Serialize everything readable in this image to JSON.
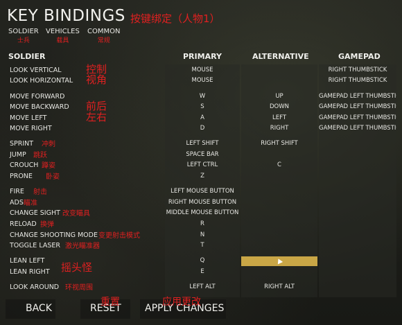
{
  "title": "KEY BINDINGS",
  "title_note": "按键绑定（人物1）",
  "tabs": [
    {
      "label": "SOLDIER",
      "note": "士兵"
    },
    {
      "label": "VEHICLES",
      "note": "载具"
    },
    {
      "label": "COMMON",
      "note": "常规"
    }
  ],
  "table": {
    "section": "SOLDIER",
    "columns": [
      "PRIMARY",
      "ALTERNATIVE",
      "GAMEPAD"
    ]
  },
  "rows": [
    {
      "action": "LOOK VERTICAL",
      "primary": "MOUSE",
      "alternative": "",
      "gamepad": "RIGHT THUMBSTICK",
      "note": "控制"
    },
    {
      "action": "LOOK HORIZONTAL",
      "primary": "MOUSE",
      "alternative": "",
      "gamepad": "RIGHT THUMBSTICK",
      "note": "视角"
    },
    {
      "action": "MOVE FORWARD",
      "primary": "W",
      "alternative": "UP",
      "gamepad": "GAMEPAD LEFT THUMBSTICK",
      "note": ""
    },
    {
      "action": "MOVE BACKWARD",
      "primary": "S",
      "alternative": "DOWN",
      "gamepad": "GAMEPAD LEFT THUMBSTICK D",
      "note": "前后"
    },
    {
      "action": "MOVE LEFT",
      "primary": "A",
      "alternative": "LEFT",
      "gamepad": "GAMEPAD LEFT THUMBSTICK L",
      "note": "左右"
    },
    {
      "action": "MOVE RIGHT",
      "primary": "D",
      "alternative": "RIGHT",
      "gamepad": "GAMEPAD LEFT THUMBSTICK R",
      "note": ""
    },
    {
      "action": "SPRINT",
      "primary": "LEFT SHIFT",
      "alternative": "RIGHT SHIFT",
      "gamepad": "",
      "note": "冲刺"
    },
    {
      "action": "JUMP",
      "primary": "SPACE BAR",
      "alternative": "",
      "gamepad": "",
      "note": "跳跃"
    },
    {
      "action": "CROUCH",
      "primary": "LEFT CTRL",
      "alternative": "C",
      "gamepad": "",
      "note": "蹲姿"
    },
    {
      "action": "PRONE",
      "primary": "Z",
      "alternative": "",
      "gamepad": "",
      "note": "卧姿"
    },
    {
      "action": "FIRE",
      "primary": "LEFT MOUSE BUTTON",
      "alternative": "",
      "gamepad": "",
      "note": "射击"
    },
    {
      "action": "ADS",
      "primary": "RIGHT MOUSE BUTTON",
      "alternative": "",
      "gamepad": "",
      "note": "瞄准"
    },
    {
      "action": "CHANGE SIGHT",
      "primary": "MIDDLE MOUSE BUTTON",
      "alternative": "",
      "gamepad": "",
      "note": "改变瞄具"
    },
    {
      "action": "RELOAD",
      "primary": "R",
      "alternative": "",
      "gamepad": "",
      "note": "换弹"
    },
    {
      "action": "CHANGE SHOOTING MODE",
      "primary": "N",
      "alternative": "",
      "gamepad": "",
      "note": "变更射击模式"
    },
    {
      "action": "TOGGLE LASER",
      "primary": "T",
      "alternative": "",
      "gamepad": "",
      "note": "激光瞄准器"
    },
    {
      "action": "LEAN LEFT",
      "primary": "Q",
      "alternative": "",
      "gamepad": "",
      "note": ""
    },
    {
      "action": "LEAN RIGHT",
      "primary": "E",
      "alternative": "",
      "gamepad": "",
      "note": ""
    },
    {
      "action": "LOOK AROUND",
      "primary": "LEFT ALT",
      "alternative": "RIGHT ALT",
      "gamepad": "",
      "note": "环视周围"
    }
  ],
  "lean_note": "摇头怪",
  "buttons": {
    "back": "BACK",
    "reset": "RESET",
    "apply": "APPLY CHANGES"
  },
  "button_notes": {
    "reset": "重置",
    "apply": "应用更改"
  },
  "colors": {
    "accent": "#c9a646",
    "annotation": "#e02020"
  }
}
